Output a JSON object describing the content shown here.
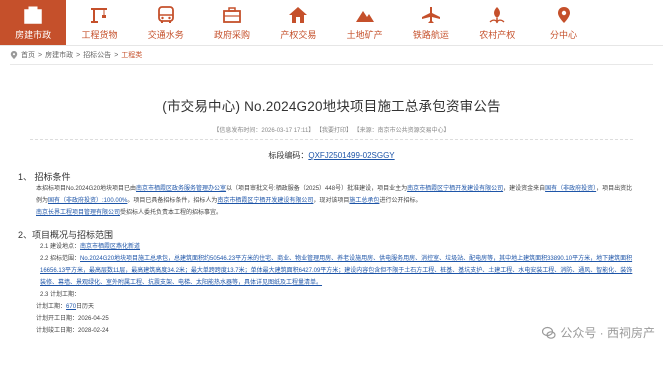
{
  "nav": [
    {
      "label": "房建市政",
      "icon": "building-icon",
      "active": true
    },
    {
      "label": "工程货物",
      "icon": "crane-icon",
      "active": false
    },
    {
      "label": "交通水务",
      "icon": "bus-icon",
      "active": false
    },
    {
      "label": "政府采购",
      "icon": "office-icon",
      "active": false
    },
    {
      "label": "产权交易",
      "icon": "house-icon",
      "active": false
    },
    {
      "label": "土地矿产",
      "icon": "mountain-icon",
      "active": false
    },
    {
      "label": "铁路航运",
      "icon": "plane-icon",
      "active": false
    },
    {
      "label": "农村产权",
      "icon": "farm-icon",
      "active": false
    },
    {
      "label": "分中心",
      "icon": "location-icon",
      "active": false
    }
  ],
  "breadcrumb": {
    "home": "首页",
    "l2": "房建市政",
    "l3": "招标公告",
    "current": "工程类"
  },
  "notice": {
    "title": "(市交易中心) No.2024G20地块项目施工总承包资审公告",
    "meta": "【信息发布时间：2026-03-17 17:11】 【我要打印】 【来源：南京市公共资源交易中心】",
    "code_label": "标段编码：",
    "code": "QXFJ2501499-02SGGY",
    "s1_title": "1、 招标条件",
    "s1_p1a": "本招标项目No.2024G20地块项目已由",
    "s1_p1b": "南京市栖霞区政务服务管理办公室",
    "s1_p1c": "以（项目审批文号:栖政服备（2025）448号）批准建设，项目业主为",
    "s1_p1d": "南京市栖霞区宁栖开发建设有限公司",
    "s1_p1e": "，建设资金来自",
    "s1_p1f": "国有（非政府投资）",
    "s1_p1g": "，项目出资比例为",
    "s1_p1h": "国有（非政府投资）:100.00%",
    "s1_p1i": "。项目已具备招标条件，招标人为",
    "s1_p1j": "南京市栖霞区宁栖开发建设有限公司",
    "s1_p1k": "，现对该项目",
    "s1_p1l": "施工总承包",
    "s1_p1m": "进行公开招标。",
    "s1_p2a": "南京长界工程项目管理有限公司",
    "s1_p2b": "受招标人委托负责本工程的招标事宜。",
    "s2_title": "2、项目概况与招标范围",
    "s2_1a": "2.1 建设地点：",
    "s2_1b": "南京市栖霞区燕化新道",
    "s2_2a": "2.2 招标范围：",
    "s2_2b": "No.2024G20地块项目施工总承包，总建筑面积约50546.23平方米的住宅、商业、物业管理用房、养老设施用房、供电服务用房、消控室、垃圾站、配电房等，其中地上建筑面积33890.10平方米，地下建筑面积16656.13平方米，最高层数11层，最高建筑高度34.2米；最大单跨跨度13.7米；单体最大建筑面积6427.09平方米；建设内容包含但不限于土石方工程、桩基、基坑支护、土建工程、水电安装工程、消防、通风、智能化、装饰装修、幕墙、景观绿化、室外附属工程、抗震支架、电梯、太阳能热水器等，具体详见图纸及工程量清单。",
    "s2_3": "2.3 计划工期：",
    "s2_3_days_a": "计划工期：",
    "s2_3_days_b": "670",
    "s2_3_days_c": "日历天",
    "s2_3_start": "计划开工日期：2026-04-25",
    "s2_3_end": "计划竣工日期：2028-02-24"
  },
  "watermark": "公众号 · 西祠房产"
}
